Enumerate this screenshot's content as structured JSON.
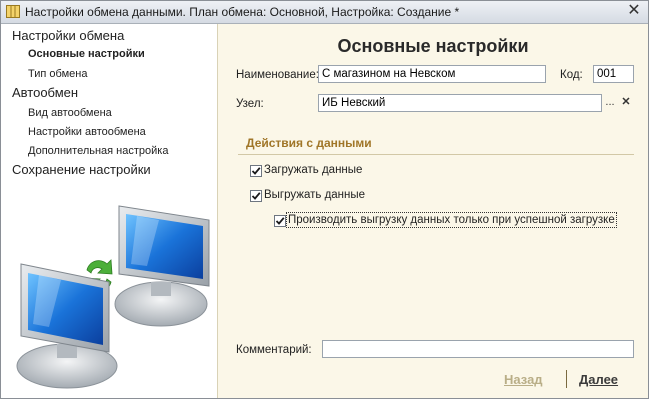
{
  "window": {
    "title": "Настройки обмена данными. План обмена: Основной, Настройка: Создание *",
    "app_icon": "table-icon",
    "close_icon": "close-icon"
  },
  "sidebar": {
    "sections": [
      {
        "label": "Настройки обмена",
        "items": [
          {
            "label": "Основные настройки",
            "active": true
          },
          {
            "label": "Тип обмена",
            "active": false
          }
        ]
      },
      {
        "label": "Автообмен",
        "items": [
          {
            "label": "Вид автообмена",
            "active": false
          },
          {
            "label": "Настройки автообмена",
            "active": false
          },
          {
            "label": "Дополнительная настройка",
            "active": false
          }
        ]
      },
      {
        "label": "Сохранение настройки",
        "items": []
      }
    ]
  },
  "main": {
    "heading": "Основные настройки",
    "name_label": "Наименование:",
    "name_value": "С магазином на Невском",
    "code_label": "Код:",
    "code_value": "001",
    "node_label": "Узел:",
    "node_value": "ИБ Невский",
    "node_select_button": "...",
    "node_clear_button": "✕",
    "data_actions_title": "Действия с данными",
    "checkboxes": {
      "load": {
        "label": "Загружать данные",
        "checked": true
      },
      "unload": {
        "label": "Выгружать данные",
        "checked": true
      },
      "unload_only_on_success": {
        "label": "Производить выгрузку данных только при успешной загрузке",
        "checked": true
      }
    },
    "comment_label": "Комментарий:",
    "comment_value": ""
  },
  "footer": {
    "back_label": "Назад",
    "next_label": "Далее"
  },
  "colors": {
    "background": "#fbf7e8",
    "section_title": "#a07628",
    "back_disabled": "#b9ae87"
  }
}
